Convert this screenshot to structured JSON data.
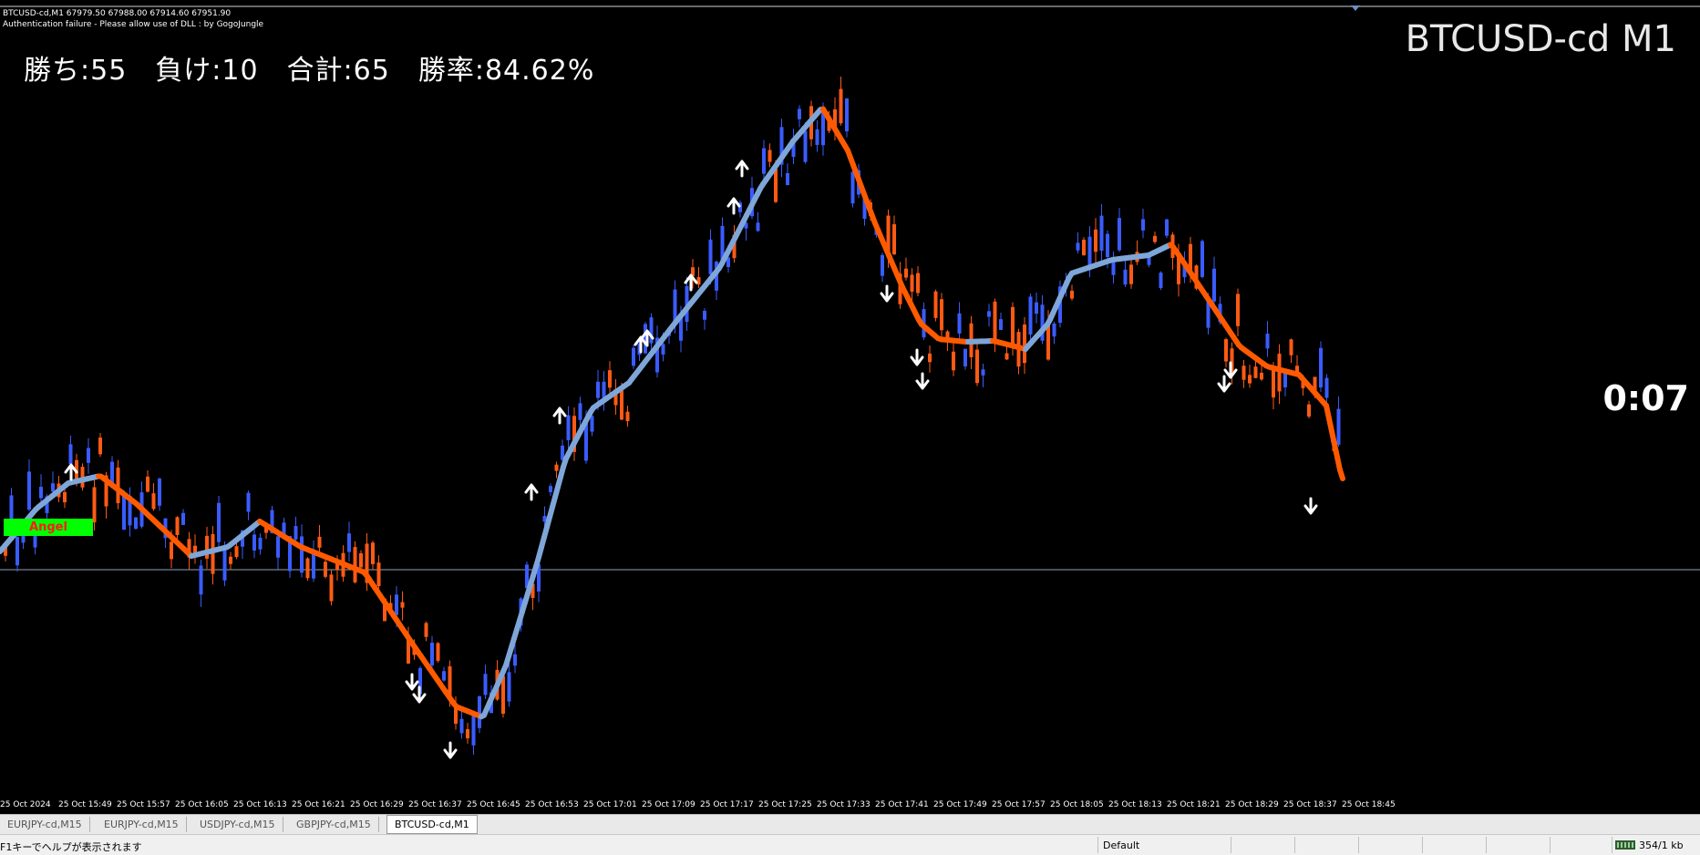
{
  "chart": {
    "info_line1": "BTCUSD-cd,M1  67979.50 67988.00 67914.60 67951.90",
    "info_line2": "Authentication failure - Please allow use of DLL : by GogoJungle",
    "stats": "勝ち:55　負け:10　合計:65　勝率:84.62%",
    "symbol_title": "BTCUSD-cd M1",
    "timer": "0:07",
    "angel_label": "Angel",
    "colors": {
      "background": "#000000",
      "bull_candle": "#3a5cff",
      "bear_candle": "#ff5a14",
      "ma_up": "#7ea6d8",
      "ma_down": "#ff5a00",
      "arrow": "#ffffff"
    }
  },
  "time_axis": {
    "labels": [
      "25 Oct 2024",
      "25 Oct 15:49",
      "25 Oct 15:57",
      "25 Oct 16:05",
      "25 Oct 16:13",
      "25 Oct 16:21",
      "25 Oct 16:29",
      "25 Oct 16:37",
      "25 Oct 16:45",
      "25 Oct 16:53",
      "25 Oct 17:01",
      "25 Oct 17:09",
      "25 Oct 17:17",
      "25 Oct 17:25",
      "25 Oct 17:33",
      "25 Oct 17:41",
      "25 Oct 17:49",
      "25 Oct 17:57",
      "25 Oct 18:05",
      "25 Oct 18:13",
      "25 Oct 18:21",
      "25 Oct 18:29",
      "25 Oct 18:37",
      "25 Oct 18:45"
    ]
  },
  "tabs": [
    {
      "label": "EURJPY-cd,M15"
    },
    {
      "label": "EURJPY-cd,M15"
    },
    {
      "label": "USDJPY-cd,M15"
    },
    {
      "label": "GBPJPY-cd,M15"
    },
    {
      "label": "BTCUSD-cd,M1",
      "active": true
    }
  ],
  "status": {
    "help": "F1キーでヘルプが表示されます",
    "profile": "Default",
    "traffic": "354/1 kb"
  }
}
